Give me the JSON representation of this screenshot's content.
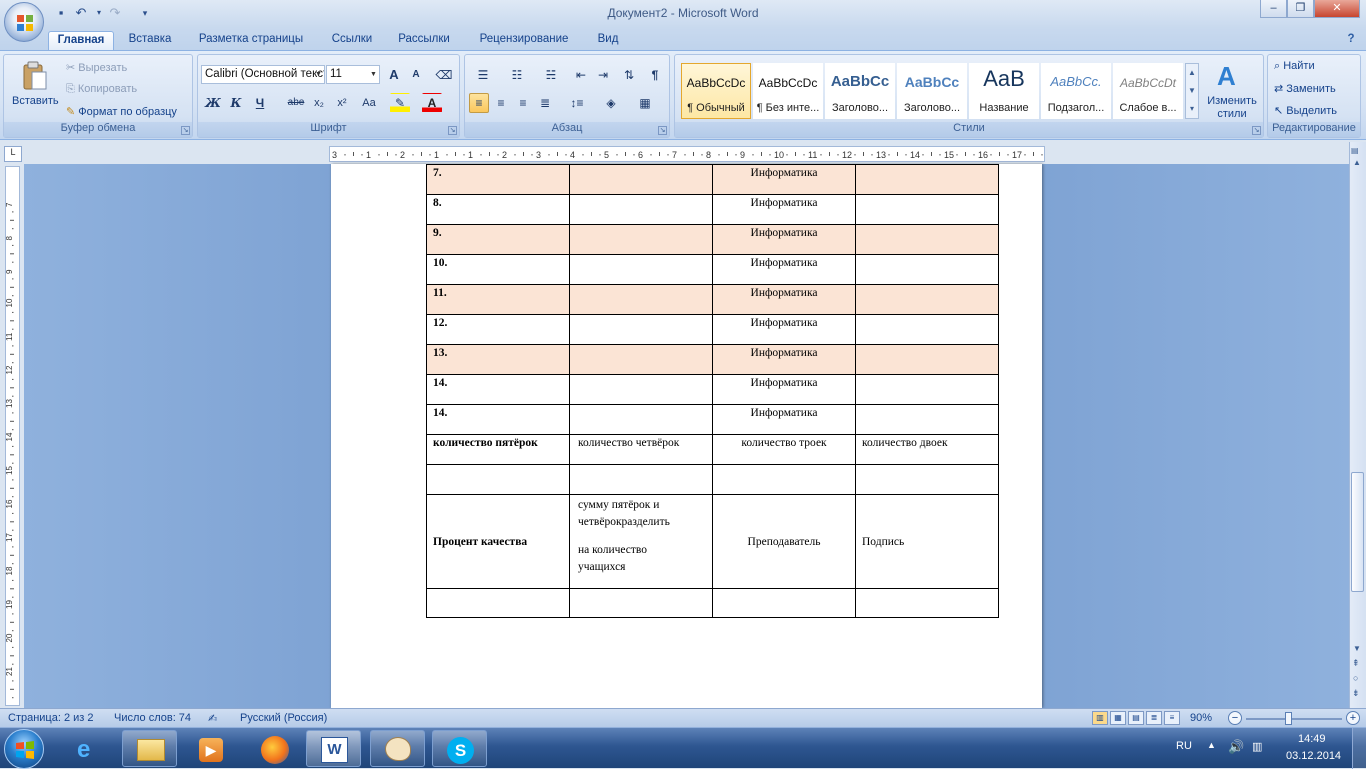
{
  "window": {
    "title": "Документ2 - Microsoft Word",
    "minimize_label": "–",
    "maximize_label": "❐",
    "close_label": "✕",
    "help_label": "?"
  },
  "tabs": [
    {
      "label": "Главная"
    },
    {
      "label": "Вставка"
    },
    {
      "label": "Разметка страницы"
    },
    {
      "label": "Ссылки"
    },
    {
      "label": "Рассылки"
    },
    {
      "label": "Рецензирование"
    },
    {
      "label": "Вид"
    }
  ],
  "ribbon": {
    "clipboard": {
      "label": "Буфер обмена",
      "paste": "Вставить",
      "cut": "Вырезать",
      "copy": "Копировать",
      "format_painter": "Формат по образцу"
    },
    "font": {
      "label": "Шрифт",
      "font_name": "Calibri (Основной текст)",
      "font_size": "11",
      "bold": "Ж",
      "italic": "К",
      "underline": "Ч",
      "strike": "abe",
      "subscript": "x₂",
      "superscript": "x²",
      "case": "Aa",
      "grow": "A",
      "shrink": "A"
    },
    "paragraph": {
      "label": "Абзац",
      "pilcrow": "¶"
    },
    "styles": {
      "label": "Стили",
      "change_styles": "Изменить стили",
      "items": [
        {
          "sample": "AaBbCcDc",
          "name": "¶ Обычный"
        },
        {
          "sample": "AaBbCcDc",
          "name": "¶ Без инте..."
        },
        {
          "sample": "AaBbCc",
          "name": "Заголово..."
        },
        {
          "sample": "AaBbCc",
          "name": "Заголово..."
        },
        {
          "sample": "AaB",
          "name": "Название"
        },
        {
          "sample": "AaBbCc.",
          "name": "Подзагол..."
        },
        {
          "sample": "AaBbCcDt",
          "name": "Слабое в..."
        }
      ]
    },
    "editing": {
      "label": "Редактирование",
      "find": "Найти",
      "replace": "Заменить",
      "select": "Выделить"
    }
  },
  "ruler": {
    "h_numbers": [
      "3",
      "1",
      "2",
      "1",
      "1",
      "2",
      "3",
      "4",
      "5",
      "6",
      "7",
      "8",
      "9",
      "10",
      "11",
      "12",
      "13",
      "14",
      "15",
      "16",
      "17"
    ],
    "v_numbers": [
      "7",
      "8",
      "9",
      "10",
      "11",
      "12",
      "13",
      "14",
      "15",
      "16",
      "17",
      "18",
      "19",
      "20",
      "21"
    ]
  },
  "table": {
    "rows": [
      {
        "num": "7.",
        "subject": "Информатика",
        "shaded": true
      },
      {
        "num": "8.",
        "subject": "Информатика",
        "shaded": false
      },
      {
        "num": "9.",
        "subject": "Информатика",
        "shaded": true
      },
      {
        "num": "10.",
        "subject": "Информатика",
        "shaded": false
      },
      {
        "num": "11.",
        "subject": "Информатика",
        "shaded": true
      },
      {
        "num": "12.",
        "subject": "Информатика",
        "shaded": false
      },
      {
        "num": "13.",
        "subject": "Информатика",
        "shaded": true
      },
      {
        "num": "14.",
        "subject": "Информатика",
        "shaded": false
      },
      {
        "num": "14.",
        "subject": "Информатика",
        "shaded": false
      }
    ],
    "counts": [
      "количество пятёрок",
      "количество четвёрок",
      "количество троек",
      "количество двоек"
    ],
    "quality_label": "Процент качества",
    "quality_formula_1": "сумму пятёрок и",
    "quality_formula_2": "четвёрокразделить",
    "quality_formula_3": "на количество",
    "quality_formula_4": "учащихся",
    "teacher": "Преподаватель",
    "signature": "Подпись"
  },
  "status": {
    "page": "Страница: 2 из 2",
    "words": "Число слов: 74",
    "language": "Русский (Россия)",
    "zoom": "90%",
    "zoom_minus": "−",
    "zoom_plus": "+"
  },
  "taskbar": {
    "lang": "RU",
    "time": "14:49",
    "date": "03.12.2014",
    "apps": [
      "explorer-icon",
      "ie-icon",
      "folder-icon",
      "media-player-icon",
      "firefox-icon",
      "word-icon",
      "paint-icon",
      "skype-icon"
    ]
  },
  "colors": {
    "ribbon_bg": "#d6e3f4",
    "row_shade": "#fbe4d5",
    "workspace": "#6c93c9",
    "taskbar": "#2e5691"
  }
}
